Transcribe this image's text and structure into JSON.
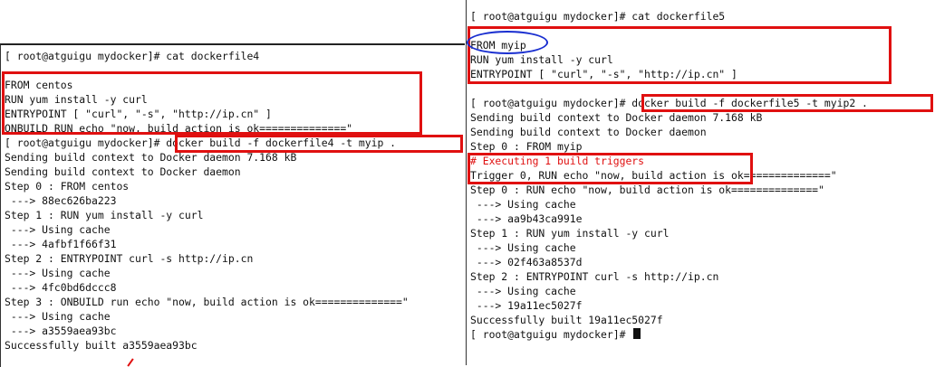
{
  "left_terminal": {
    "lines": [
      "[ root@atguigu mydocker]# cat dockerfile4",
      "",
      "FROM centos",
      "RUN yum install -y curl",
      "ENTRYPOINT [ \"curl\", \"-s\", \"http://ip.cn\" ]",
      "ONBUILD RUN echo \"now, build action is ok==============\"",
      "[ root@atguigu mydocker]# docker build -f dockerfile4 -t myip .",
      "Sending build context to Docker daemon 7.168 kB",
      "Sending build context to Docker daemon",
      "Step 0 : FROM centos",
      " ---> 88ec626ba223",
      "Step 1 : RUN yum install -y curl",
      " ---> Using cache",
      " ---> 4afbf1f66f31",
      "Step 2 : ENTRYPOINT curl -s http://ip.cn",
      " ---> Using cache",
      " ---> 4fc0bd6dccc8",
      "Step 3 : ONBUILD run echo \"now, build action is ok==============\"",
      " ---> Using cache",
      " ---> a3559aea93bc",
      "Successfully built a3559aea93bc"
    ]
  },
  "right_terminal": {
    "lines": [
      "[ root@atguigu mydocker]# cat dockerfile5",
      "",
      "FROM myip",
      "RUN yum install -y curl",
      "ENTRYPOINT [ \"curl\", \"-s\", \"http://ip.cn\" ]",
      "",
      "[ root@atguigu mydocker]# docker build -f dockerfile5 -t myip2 .",
      "Sending build context to Docker daemon 7.168 kB",
      "Sending build context to Docker daemon",
      "Step 0 : FROM myip",
      "# Executing 1 build triggers",
      "Trigger 0, RUN echo \"now, build action is ok==============\"",
      "Step 0 : RUN echo \"now, build action is ok==============\"",
      " ---> Using cache",
      " ---> aa9b43ca991e",
      "Step 1 : RUN yum install -y curl",
      " ---> Using cache",
      " ---> 02f463a8537d",
      "Step 2 : ENTRYPOINT curl -s http://ip.cn",
      " ---> Using cache",
      " ---> 19a11ec5027f",
      "Successfully built 19a11ec5027f",
      "[ root@atguigu mydocker]# "
    ]
  },
  "colors": {
    "highlight": "#e01010",
    "ellipse": "#1a2fd0",
    "text": "#111111"
  }
}
